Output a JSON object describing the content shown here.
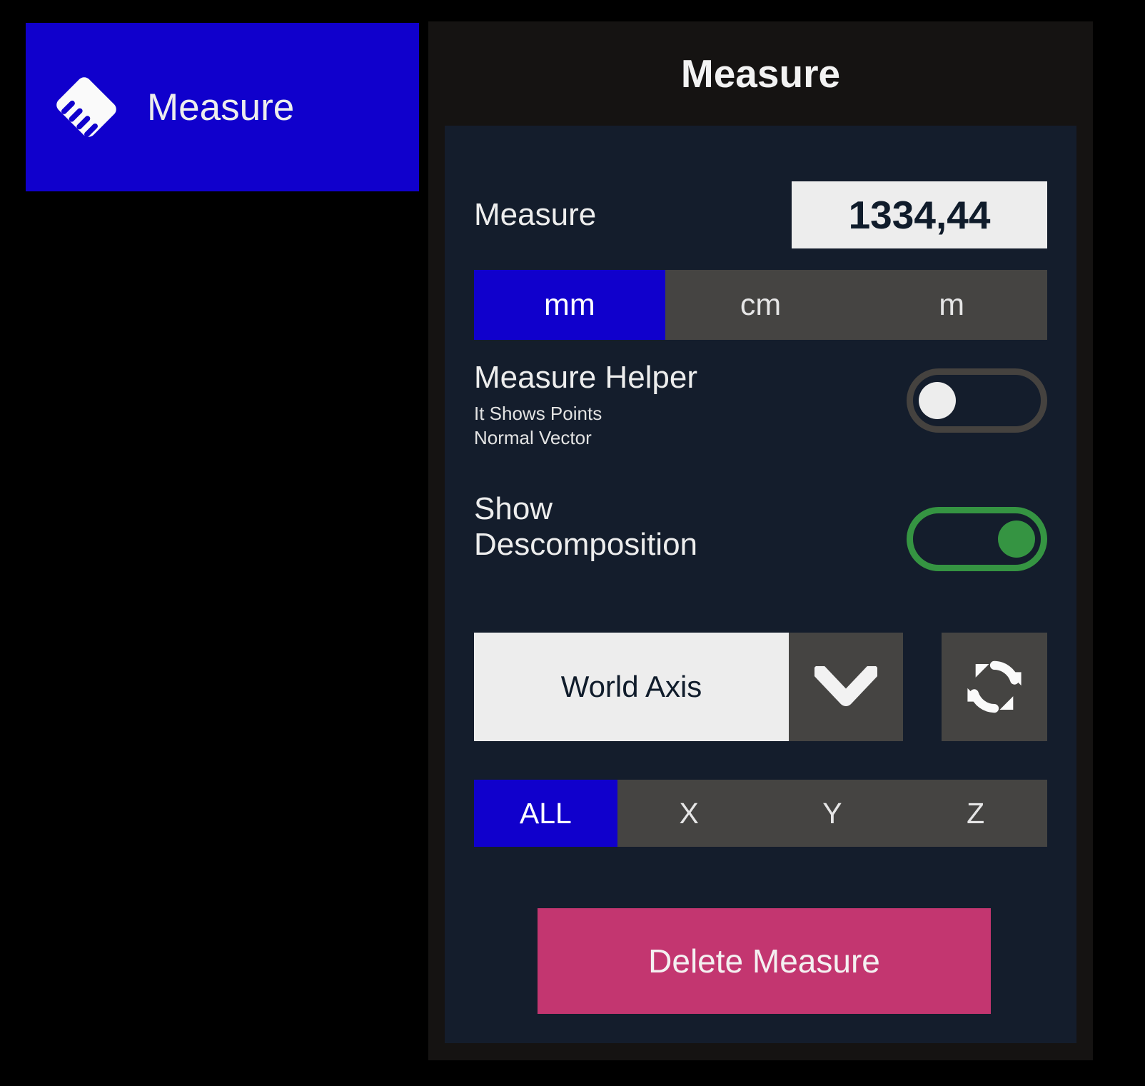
{
  "colors": {
    "accent_blue": "#1000CC",
    "panel_dark": "#151312",
    "card_navy": "#141D2C",
    "segment_gray": "#454442",
    "toggle_on_green": "#359442",
    "toggle_off_gray": "#45423F",
    "delete_pink": "#C33670",
    "light_field": "#EDEDED",
    "text_light": "#EDEDED",
    "text_dark": "#101C2B"
  },
  "tool_button": {
    "label": "Measure",
    "icon": "ruler-icon"
  },
  "panel": {
    "title": "Measure",
    "measure": {
      "label": "Measure",
      "value": "1334,44"
    },
    "units": {
      "options": [
        {
          "label": "mm",
          "selected": true
        },
        {
          "label": "cm",
          "selected": false
        },
        {
          "label": "m",
          "selected": false
        }
      ]
    },
    "measure_helper": {
      "title": "Measure Helper",
      "sub_line1": "It Shows Points",
      "sub_line2": "Normal Vector",
      "enabled": false
    },
    "show_descomposition": {
      "title": "Show\nDescomposition",
      "enabled": true
    },
    "axis_dropdown": {
      "value": "World Axis",
      "arrow_icon": "chevron-down-icon",
      "refresh_icon": "refresh-icon"
    },
    "axis_filter": {
      "options": [
        {
          "label": "ALL",
          "selected": true
        },
        {
          "label": "X",
          "selected": false
        },
        {
          "label": "Y",
          "selected": false
        },
        {
          "label": "Z",
          "selected": false
        }
      ]
    },
    "delete_button": {
      "label": "Delete Measure"
    }
  }
}
